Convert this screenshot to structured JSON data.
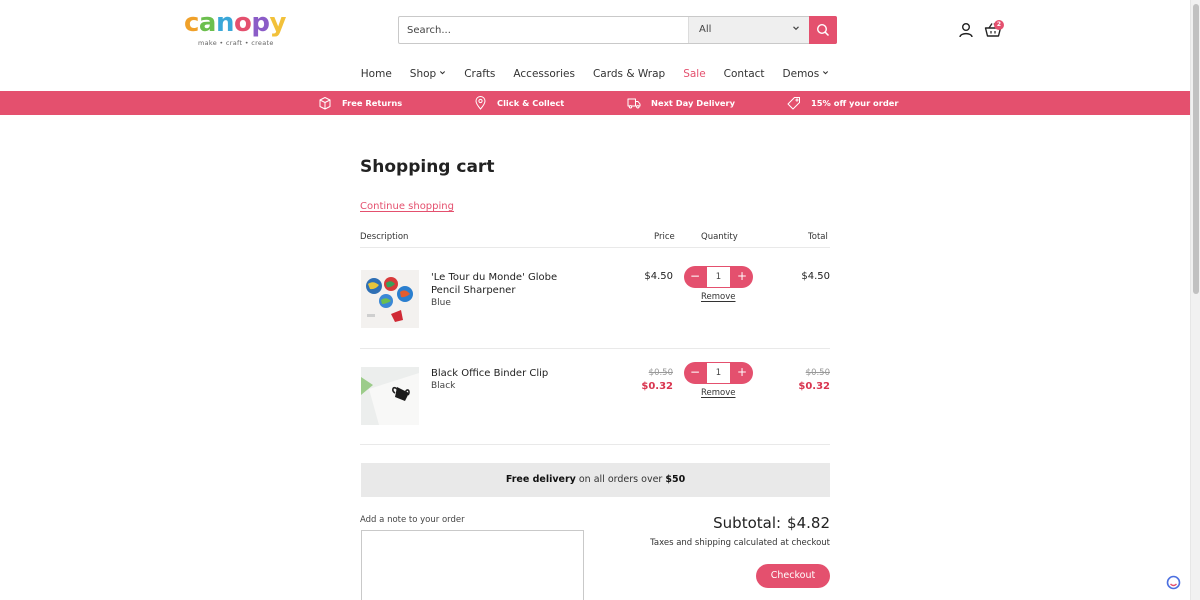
{
  "brand": {
    "letters": [
      "c",
      "a",
      "n",
      "o",
      "p",
      "y"
    ],
    "letter_colors": [
      "#f0a12a",
      "#6cbf4e",
      "#3aa7d8",
      "#e4506e",
      "#8b5cc7",
      "#f2c13a"
    ],
    "tagline": "make • craft • create"
  },
  "colors": {
    "accent": "#e4506e",
    "sale": "#d9354f"
  },
  "header": {
    "search_placeholder": "Search...",
    "search_category": "All",
    "cart_count": "2"
  },
  "nav": {
    "items": [
      {
        "label": "Home"
      },
      {
        "label": "Shop"
      },
      {
        "label": "Crafts"
      },
      {
        "label": "Accessories"
      },
      {
        "label": "Cards & Wrap"
      },
      {
        "label": "Sale"
      },
      {
        "label": "Contact"
      },
      {
        "label": "Demos"
      }
    ]
  },
  "promo": {
    "items": [
      {
        "label": "Free Returns",
        "icon": "box-icon"
      },
      {
        "label": "Click & Collect",
        "icon": "location-pin-icon"
      },
      {
        "label": "Next Day Delivery",
        "icon": "truck-icon"
      },
      {
        "label": "15% off your order",
        "icon": "tag-icon"
      }
    ]
  },
  "cart": {
    "title": "Shopping cart",
    "continue_label": "Continue shopping",
    "headers": {
      "description": "Description",
      "price": "Price",
      "quantity": "Quantity",
      "total": "Total"
    },
    "items": [
      {
        "name_line1": "'Le Tour du Monde' Globe",
        "name_line2": "Pencil Sharpener",
        "variant": "Blue",
        "price": "$4.50",
        "quantity": "1",
        "remove_label": "Remove",
        "total": "$4.50"
      },
      {
        "name_line1": "Black Office Binder Clip",
        "variant": "Black",
        "price_old": "$0.50",
        "price_sale": "$0.32",
        "quantity": "1",
        "remove_label": "Remove",
        "total_old": "$0.50",
        "total_sale": "$0.32"
      }
    ],
    "qty_minus": "−",
    "qty_plus": "+",
    "free_delivery": {
      "bold1": "Free delivery",
      "mid": " on all orders over ",
      "bold2": "$50"
    },
    "note_label": "Add a note to your order",
    "subtotal_label": "Subtotal:",
    "subtotal_value": "$4.82",
    "taxes_note": "Taxes and shipping calculated at checkout",
    "checkout_label": "Checkout"
  }
}
